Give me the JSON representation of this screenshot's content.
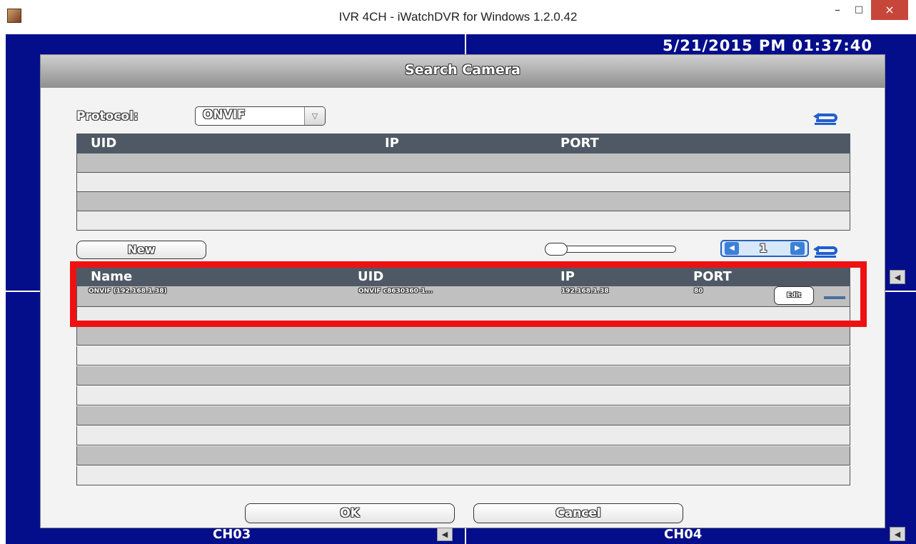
{
  "window": {
    "title": "IVR 4CH - iWatchDVR for Windows 1.2.0.42",
    "minimize": "–",
    "maximize": "□",
    "close": "×"
  },
  "background": {
    "datetime": "5/21/2015 PM 01:37:40",
    "channels": [
      "CH03",
      "CH04"
    ]
  },
  "dialog": {
    "title": "Search Camera",
    "protocol_label": "Protocol:",
    "protocol_value": "ONVIF",
    "search_table": {
      "columns": [
        "UID",
        "IP",
        "PORT"
      ],
      "rows": []
    },
    "new_button": "New",
    "pager": {
      "page": "1"
    },
    "added_table": {
      "columns": [
        "Name",
        "UID",
        "IP",
        "PORT"
      ],
      "rows": [
        {
          "name": "ONVIF (192.168.1.38)",
          "uid": "ONVIF c8630360-1...",
          "ip": "192.168.1.38",
          "port": "80",
          "edit": "Edit"
        }
      ]
    },
    "ok_button": "OK",
    "cancel_button": "Cancel"
  },
  "colors": {
    "desktop_blue": "#050e8a",
    "table_header": "#4f5966",
    "highlight_red": "#ee1111",
    "pager_blue": "#3c7fd6"
  }
}
